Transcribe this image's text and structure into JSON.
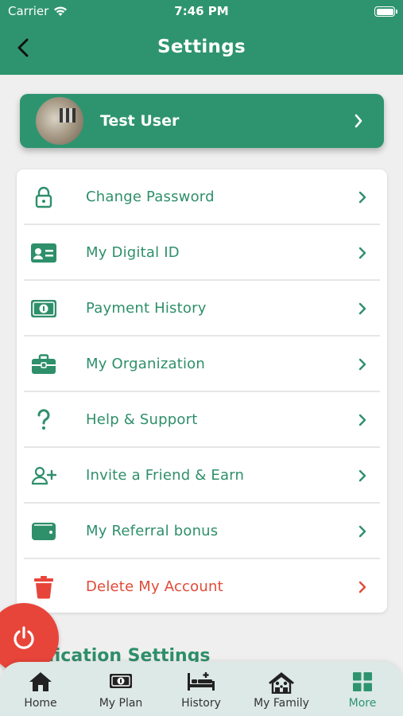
{
  "status_bar": {
    "carrier": "Carrier",
    "time": "7:46 PM"
  },
  "header": {
    "title": "Settings",
    "back_icon": "chevron-left-icon"
  },
  "profile": {
    "name": "Test User"
  },
  "menu": {
    "items": [
      {
        "label": "Change Password",
        "icon": "lock-icon"
      },
      {
        "label": "My Digital ID",
        "icon": "id-card-icon"
      },
      {
        "label": "Payment History",
        "icon": "money-bill-icon"
      },
      {
        "label": "My Organization",
        "icon": "briefcase-icon"
      },
      {
        "label": "Help & Support",
        "icon": "question-icon"
      },
      {
        "label": "Invite a Friend & Earn",
        "icon": "user-plus-icon"
      },
      {
        "label": "My Referral bonus",
        "icon": "wallet-icon"
      },
      {
        "label": "Delete My Account",
        "icon": "trash-icon"
      }
    ]
  },
  "section_title": "fication Settings",
  "tabs": [
    {
      "label": "Home",
      "icon": "home-icon"
    },
    {
      "label": "My Plan",
      "icon": "money-bill-icon"
    },
    {
      "label": "History",
      "icon": "bed-icon"
    },
    {
      "label": "My Family",
      "icon": "family-home-icon"
    },
    {
      "label": "More",
      "icon": "grid-icon",
      "active": true
    }
  ],
  "colors": {
    "primary": "#2e9470",
    "text_green": "#2e8f6b",
    "danger": "#e04a37",
    "background": "#efefef",
    "tabbar": "#dde9e6"
  }
}
